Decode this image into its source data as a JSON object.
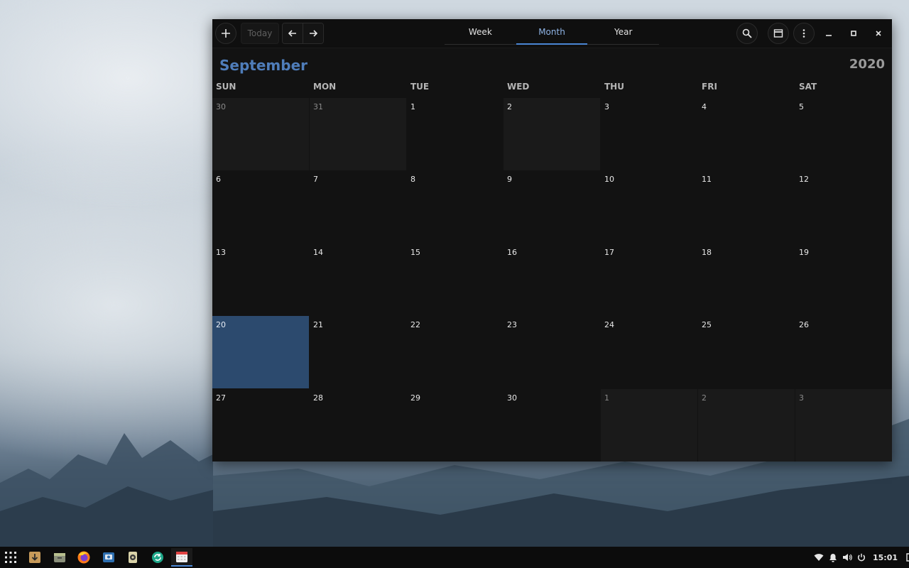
{
  "headerbar": {
    "today_label": "Today",
    "tabs": [
      {
        "label": "Week",
        "active": false
      },
      {
        "label": "Month",
        "active": true
      },
      {
        "label": "Year",
        "active": false
      }
    ]
  },
  "calendar": {
    "month": "September",
    "year": "2020",
    "weekdays": [
      "SUN",
      "MON",
      "TUE",
      "WED",
      "THU",
      "FRI",
      "SAT"
    ],
    "weeks": [
      [
        "30",
        "31",
        "1",
        "2",
        "3",
        "4",
        "5"
      ],
      [
        "6",
        "7",
        "8",
        "9",
        "10",
        "11",
        "12"
      ],
      [
        "13",
        "14",
        "15",
        "16",
        "17",
        "18",
        "19"
      ],
      [
        "20",
        "21",
        "22",
        "23",
        "24",
        "25",
        "26"
      ],
      [
        "27",
        "28",
        "29",
        "30",
        "1",
        "2",
        "3"
      ]
    ],
    "today": "20",
    "accent_color": "#4f7dba",
    "today_color": "#2c4a6e"
  },
  "taskbar": {
    "clock": "15:01"
  }
}
